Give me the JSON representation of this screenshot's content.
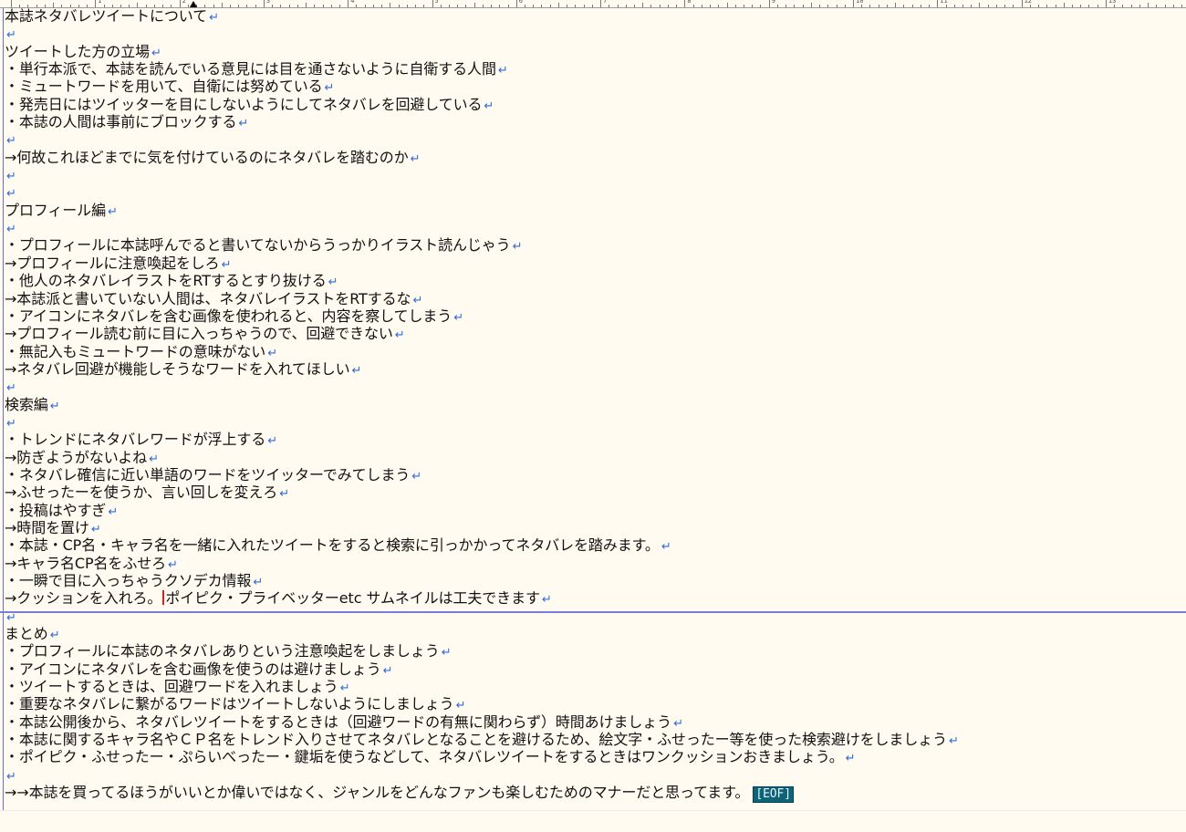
{
  "ruler": {
    "labels": [
      "1",
      "2",
      "3",
      "4",
      "5",
      "6",
      "7",
      "8",
      "9",
      "10",
      "11",
      "12",
      "13"
    ]
  },
  "document": {
    "lines": [
      "本誌ネタバレツイートについて",
      "",
      "ツイートした方の立場",
      "・単行本派で、本誌を読んでいる意見には目を通さないように自衛する人間",
      "・ミュートワードを用いて、自衛には努めている",
      "・発売日にはツイッターを目にしないようにしてネタバレを回避している",
      "・本誌の人間は事前にブロックする",
      "",
      "→何故これほどまでに気を付けているのにネタバレを踏むのか",
      "",
      "",
      "プロフィール編",
      "",
      "・プロフィールに本誌呼んでると書いてないからうっかりイラスト読んじゃう",
      "→プロフィールに注意喚起をしろ",
      "・他人のネタバレイラストをRTするとすり抜ける",
      "→本誌派と書いていない人間は、ネタバレイラストをRTするな",
      "・アイコンにネタバレを含む画像を使われると、内容を察してしまう",
      "→プロフィール読む前に目に入っちゃうので、回避できない",
      "・無記入もミュートワードの意味がない",
      "→ネタバレ回避が機能しそうなワードを入れてほしい",
      "",
      "検索編",
      "",
      "・トレンドにネタバレワードが浮上する",
      "→防ぎようがないよね",
      "・ネタバレ確信に近い単語のワードをツイッターでみてしまう",
      "→ふせったーを使うか、言い回しを変えろ",
      "・投稿はやすぎ",
      "→時間を置け",
      "・本誌・CP名・キャラ名を一緒に入れたツイートをすると検索に引っかかってネタバレを踏みます。",
      "→キャラ名CP名をふせろ",
      "・一瞬で目に入っちゃうクソデカ情報",
      "→クッションを入れろ。",
      "",
      "まとめ",
      "・プロフィールに本誌のネタバレありという注意喚起をしましょう",
      "・アイコンにネタバレを含む画像を使うのは避けましょう",
      "・ツイートするときは、回避ワードを入れましょう",
      "・重要なネタバレに繋がるワードはツイートしないようにしましょう",
      "・本誌公開後から、ネタバレツイートをするときは（回避ワードの有無に関わらず）時間あけましょう",
      "・本誌に関するキャラ名やＣＰ名をトレンド入りさせてネタバレとなることを避けるため、絵文字・ふせったー等を使った検索避けをしましょう",
      "・ポイピク・ふせったー・ぷらいべったー・鍵垢を使うなどして、ネタバレツイートをするときはワンクッションおきましょう。",
      "",
      "→→本誌を買ってるほうがいいとか偉いではなく、ジャンルをどんなファンも楽しむためのマナーだと思ってます。"
    ],
    "cursor_line_after": "ポイピク・プライベッターetc サムネイルは工夫できます",
    "return_mark": "↵",
    "eof_marker": "[EOF]"
  },
  "colors": {
    "background": "#fffbf0",
    "text": "#111111",
    "return_mark": "#2e6bd9",
    "cursor": "#e01e1e",
    "eof_bg": "#0b6478",
    "separator": "#7b7be0"
  }
}
